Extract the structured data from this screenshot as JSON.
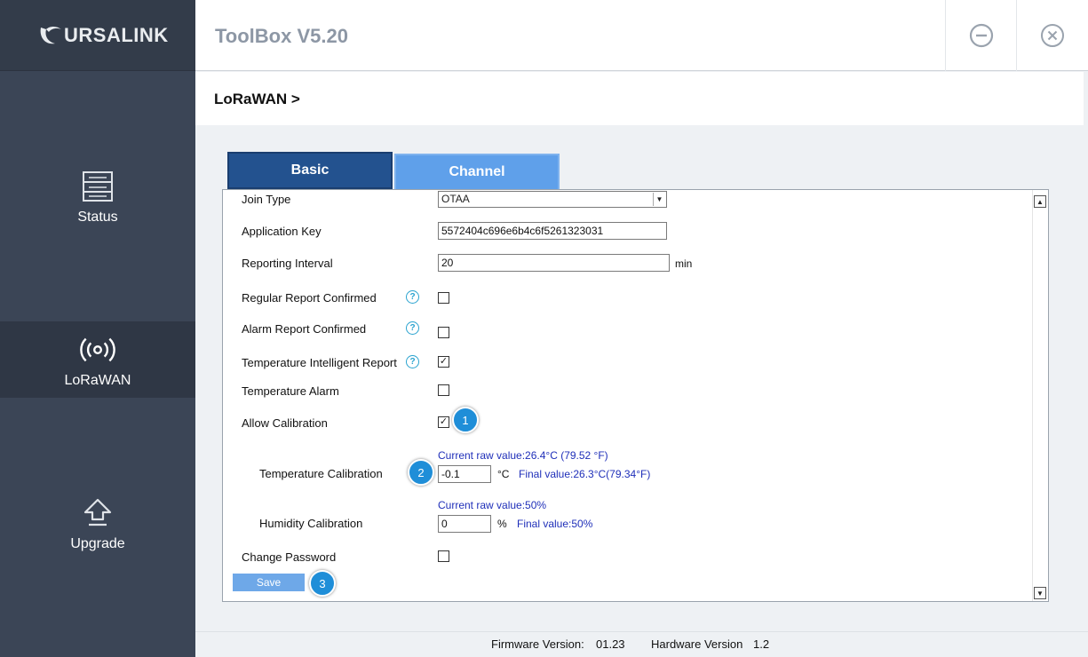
{
  "app": {
    "logo_text": "URSALINK",
    "title": "ToolBox V5.20"
  },
  "sidebar": {
    "items": [
      {
        "label": "Status",
        "icon": "server-icon"
      },
      {
        "label": "LoRaWAN",
        "icon": "radio-signal-icon",
        "active": true
      },
      {
        "label": "Upgrade",
        "icon": "upload-arrow-icon"
      }
    ]
  },
  "breadcrumb": "LoRaWAN >",
  "tabs": [
    {
      "label": "Basic",
      "active": true
    },
    {
      "label": "Channel",
      "active": false
    }
  ],
  "form": {
    "join_type": {
      "label": "Join Type",
      "value": "OTAA"
    },
    "application_key": {
      "label": "Application Key",
      "value": "5572404c696e6b4c6f5261323031"
    },
    "reporting_interval": {
      "label": "Reporting Interval",
      "value": "20",
      "unit": "min"
    },
    "regular_report_confirmed": {
      "label": "Regular Report Confirmed",
      "checked": false
    },
    "alarm_report_confirmed": {
      "label": "Alarm Report Confirmed",
      "checked": false
    },
    "temperature_intelligent_report": {
      "label": "Temperature Intelligent Report",
      "checked": true
    },
    "temperature_alarm": {
      "label": "Temperature Alarm",
      "checked": false
    },
    "allow_calibration": {
      "label": "Allow Calibration",
      "checked": true
    },
    "temperature_calibration": {
      "label": "Temperature Calibration",
      "raw": "Current raw value:26.4°C (79.52 °F)",
      "value": "-0.1",
      "unit": "°C",
      "final": "Final value:26.3°C(79.34°F)"
    },
    "humidity_calibration": {
      "label": "Humidity Calibration",
      "raw": "Current raw value:50%",
      "value": "0",
      "unit": "%",
      "final": "Final value:50%"
    },
    "change_password": {
      "label": "Change Password",
      "checked": false
    },
    "save_label": "Save",
    "help_glyph": "?",
    "check_glyph": "✓"
  },
  "badges": [
    "1",
    "2",
    "3"
  ],
  "footer": {
    "firmware_label": "Firmware Version:",
    "firmware_value": "01.23",
    "hardware_label": "Hardware Version",
    "hardware_value": "1.2"
  },
  "colors": {
    "sidebar": "#3b4556",
    "tab_active": "#23528f",
    "tab_inactive": "#5fa0ea",
    "badge": "#1f8ed8",
    "info_text": "#1f2fb9"
  }
}
